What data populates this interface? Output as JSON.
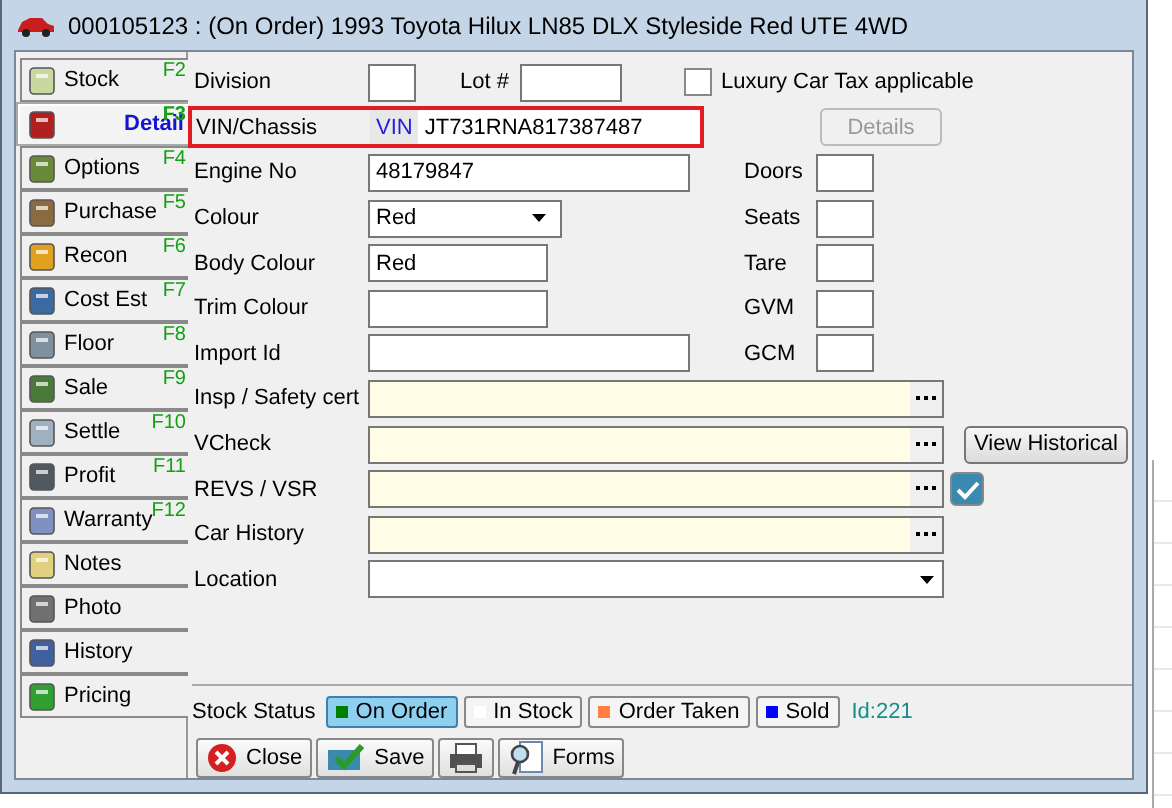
{
  "window": {
    "title": "000105123 : (On Order) 1993 Toyota Hilux LN85 DLX Styleside Red UTE 4WD"
  },
  "sidebar": {
    "items": [
      {
        "label": "Stock",
        "key": "F2",
        "selected": false
      },
      {
        "label": "Detail",
        "key": "F3",
        "selected": true
      },
      {
        "label": "Options",
        "key": "F4",
        "selected": false
      },
      {
        "label": "Purchase",
        "key": "F5",
        "selected": false
      },
      {
        "label": "Recon",
        "key": "F6",
        "selected": false
      },
      {
        "label": "Cost Est",
        "key": "F7",
        "selected": false
      },
      {
        "label": "Floor",
        "key": "F8",
        "selected": false
      },
      {
        "label": "Sale",
        "key": "F9",
        "selected": false
      },
      {
        "label": "Settle",
        "key": "F10",
        "selected": false
      },
      {
        "label": "Profit",
        "key": "F11",
        "selected": false
      },
      {
        "label": "Warranty",
        "key": "F12",
        "selected": false
      },
      {
        "label": "Notes",
        "selected": false
      },
      {
        "label": "Photo",
        "selected": false
      },
      {
        "label": "History",
        "selected": false
      },
      {
        "label": "Pricing",
        "selected": false
      }
    ]
  },
  "form": {
    "division": {
      "label": "Division"
    },
    "lot": {
      "label": "Lot #"
    },
    "luxury_tax": {
      "label": "Luxury Car Tax applicable",
      "checked": false
    },
    "vin": {
      "label": "VIN/Chassis",
      "prefix": "VIN",
      "value": "JT731RNA817387487"
    },
    "details_button": {
      "label": "Details",
      "disabled": true
    },
    "left_fields": [
      {
        "label": "Engine No",
        "kind": "text",
        "value": "48179847"
      },
      {
        "label": "Colour",
        "kind": "select",
        "value": "Red"
      },
      {
        "label": "Body Colour",
        "kind": "text",
        "value": "Red"
      },
      {
        "label": "Trim Colour",
        "kind": "text"
      },
      {
        "label": "Import Id",
        "kind": "text"
      }
    ],
    "right_fields": [
      {
        "label": "Doors"
      },
      {
        "label": "Seats"
      },
      {
        "label": "Tare"
      },
      {
        "label": "GVM"
      },
      {
        "label": "GCM"
      }
    ],
    "long_fields": [
      {
        "label": "Insp / Safety cert",
        "kind": "lookup"
      },
      {
        "label": "VCheck",
        "kind": "lookup",
        "extra_button": "View Historical"
      },
      {
        "label": "REVS / VSR",
        "kind": "lookup",
        "check_button": true
      },
      {
        "label": "Car History",
        "kind": "lookup"
      },
      {
        "label": "Location",
        "kind": "select"
      }
    ]
  },
  "stock_status": {
    "label": "Stock Status",
    "options": [
      {
        "label": "On Order",
        "color": "#008000",
        "selected": true
      },
      {
        "label": "In Stock",
        "color": "#ffffff",
        "selected": false
      },
      {
        "label": "Order Taken",
        "color": "#ff8040",
        "selected": false
      },
      {
        "label": "Sold",
        "color": "#0000ff",
        "selected": false
      }
    ],
    "id": "Id:221"
  },
  "buttons": [
    {
      "label": "Close",
      "kind": "close"
    },
    {
      "label": "Save",
      "kind": "save"
    },
    {
      "kind": "print"
    },
    {
      "label": "Forms",
      "kind": "forms"
    }
  ]
}
